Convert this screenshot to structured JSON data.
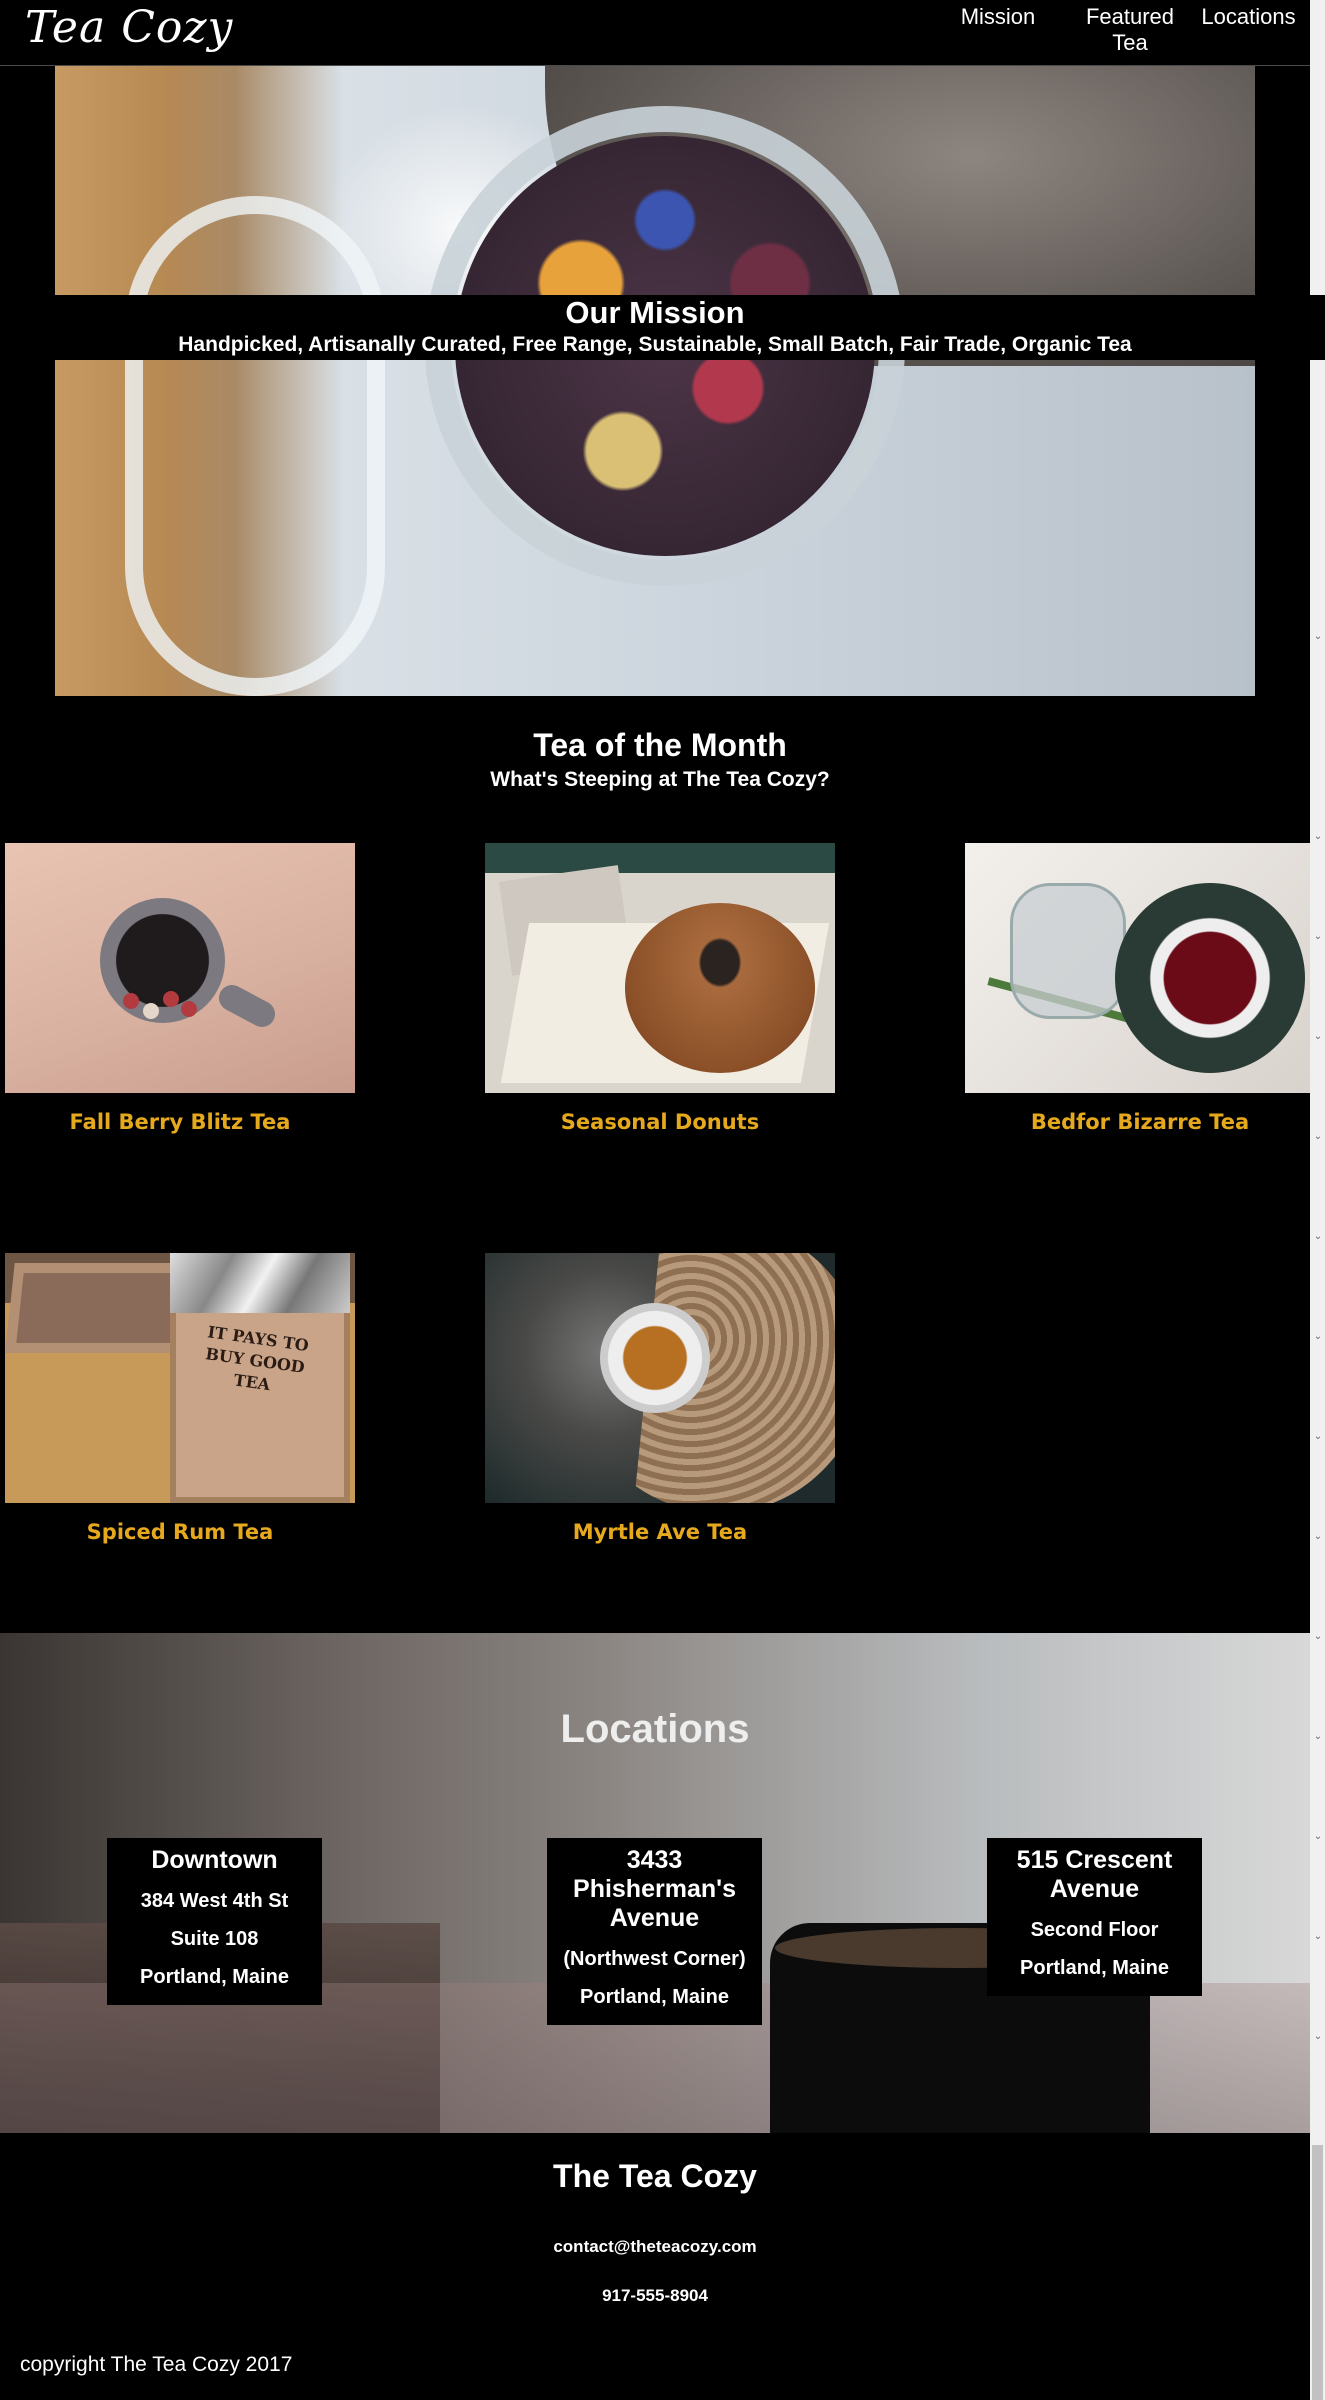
{
  "header": {
    "logo": "Tea Cozy",
    "nav": [
      "Mission",
      "Featured Tea",
      "Locations"
    ]
  },
  "mission": {
    "title": "Our Mission",
    "subtitle": "Handpicked, Artisanally Curated, Free Range, Sustainable, Small Batch, Fair Trade, Organic Tea"
  },
  "tea_of_month": {
    "title": "Tea of the Month",
    "subtitle": "What's Steeping at The Tea Cozy?",
    "items": [
      {
        "name": "Fall Berry Blitz Tea"
      },
      {
        "name": "Seasonal Donuts"
      },
      {
        "name": "Bedfor Bizarre Tea"
      },
      {
        "name": "Spiced Rum Tea",
        "box_text": "IT PAYS TO BUY GOOD TEA"
      },
      {
        "name": "Myrtle Ave Tea"
      }
    ]
  },
  "locations": {
    "title": "Locations",
    "cards": [
      {
        "name": "Downtown",
        "lines": [
          "384 West 4th St",
          "Suite 108",
          "Portland, Maine"
        ]
      },
      {
        "name": "3433 Phisherman's Avenue",
        "lines": [
          "(Northwest Corner)",
          "Portland, Maine"
        ]
      },
      {
        "name": "515 Crescent Avenue",
        "lines": [
          "Second Floor",
          "Portland, Maine"
        ]
      }
    ]
  },
  "footer": {
    "title": "The Tea Cozy",
    "email": "contact@theteacozy.com",
    "phone": "917-555-8904",
    "copyright": "copyright The Tea Cozy 2017"
  },
  "colors": {
    "background": "#000000",
    "accent_gold": "#e6a91d",
    "text": "#ffffff"
  }
}
